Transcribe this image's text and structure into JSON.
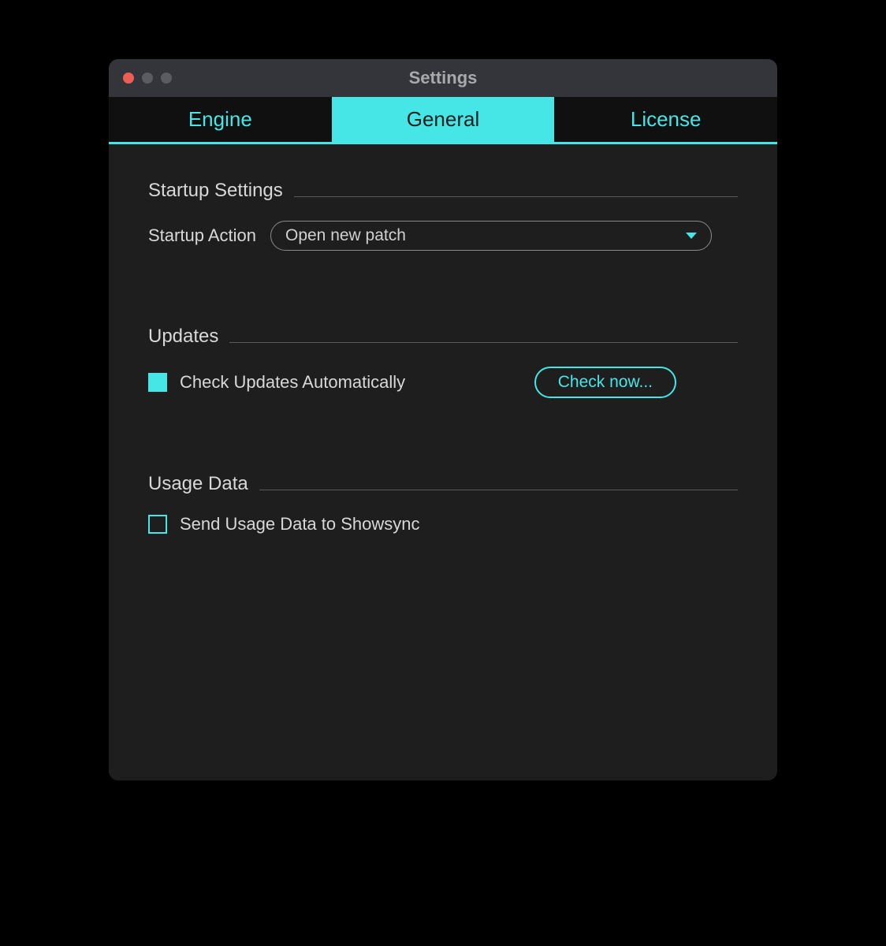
{
  "window": {
    "title": "Settings"
  },
  "tabs": {
    "engine": "Engine",
    "general": "General",
    "license": "License"
  },
  "sections": {
    "startup": {
      "title": "Startup Settings",
      "action_label": "Startup Action",
      "action_value": "Open new patch"
    },
    "updates": {
      "title": "Updates",
      "check_auto_label": "Check Updates Automatically",
      "check_auto_checked": true,
      "check_now_label": "Check now..."
    },
    "usage": {
      "title": "Usage Data",
      "send_label": "Send Usage Data to Showsync",
      "send_checked": false
    }
  }
}
